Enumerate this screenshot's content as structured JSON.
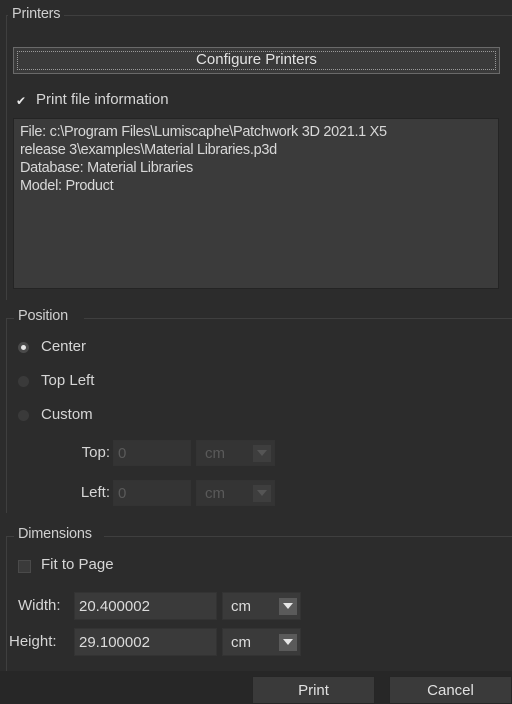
{
  "printers": {
    "group_title": "Printers",
    "configure_button": "Configure Printers",
    "print_file_info": {
      "label": "Print file information",
      "checked": true
    },
    "info_lines": [
      "File: c:\\Program Files\\Lumiscaphe\\Patchwork 3D 2021.1 X5",
      "release 3\\examples\\Material Libraries.p3d",
      "Database: Material Libraries",
      "Model: Product"
    ]
  },
  "position": {
    "group_title": "Position",
    "options": [
      {
        "label": "Center",
        "selected": true
      },
      {
        "label": "Top Left",
        "selected": false
      },
      {
        "label": "Custom",
        "selected": false
      }
    ],
    "top": {
      "label": "Top:",
      "value": "0",
      "unit": "cm"
    },
    "left": {
      "label": "Left:",
      "value": "0",
      "unit": "cm"
    }
  },
  "dimensions": {
    "group_title": "Dimensions",
    "fit_to_page": {
      "label": "Fit to Page",
      "checked": false
    },
    "width": {
      "label": "Width:",
      "value": "20.400002",
      "unit": "cm"
    },
    "height": {
      "label": "Height:",
      "value": "29.100002",
      "unit": "cm"
    }
  },
  "footer": {
    "print_button": "Print",
    "cancel_button": "Cancel"
  }
}
